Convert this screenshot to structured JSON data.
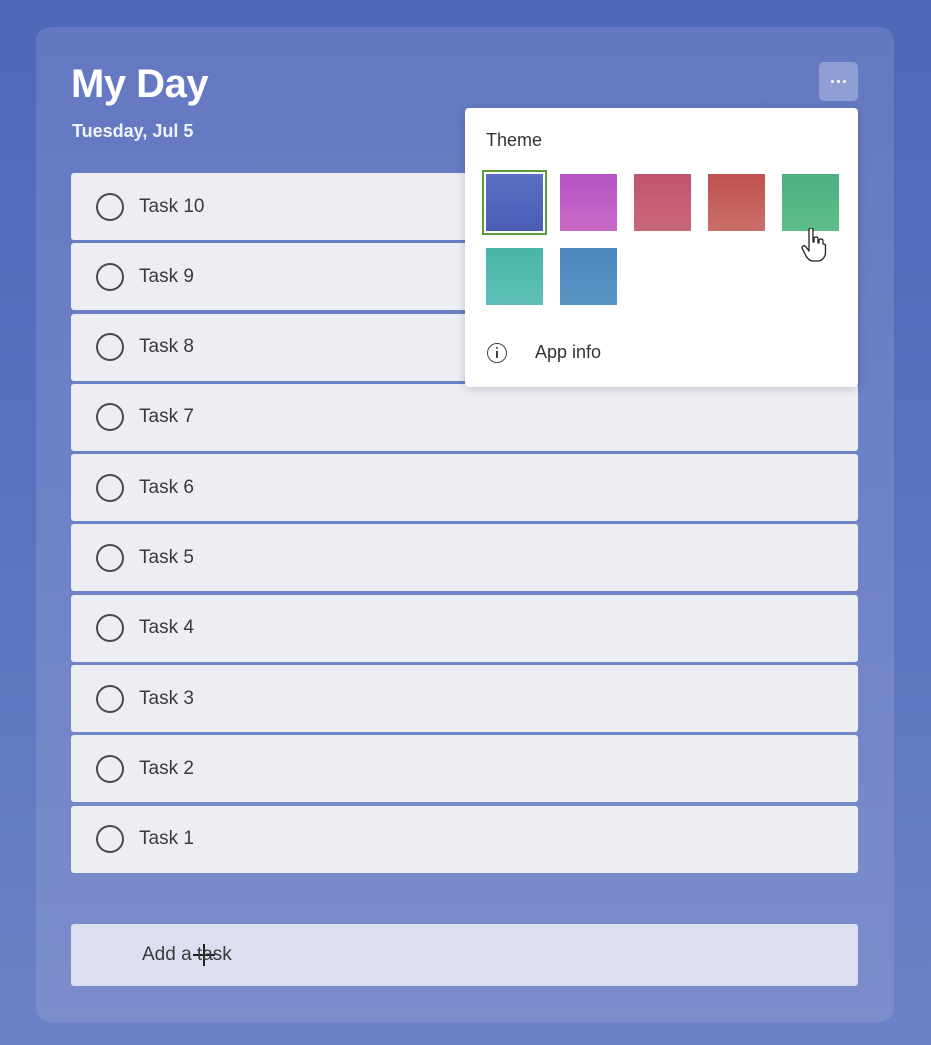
{
  "header": {
    "title": "My Day",
    "date": "Tuesday, Jul 5"
  },
  "tasks": [
    {
      "label": "Task 10"
    },
    {
      "label": "Task 9"
    },
    {
      "label": "Task 8"
    },
    {
      "label": "Task 7"
    },
    {
      "label": "Task 6"
    },
    {
      "label": "Task 5"
    },
    {
      "label": "Task 4"
    },
    {
      "label": "Task 3"
    },
    {
      "label": "Task 2"
    },
    {
      "label": "Task 1"
    }
  ],
  "add_task": {
    "label": "Add a task",
    "icon": "plus-icon"
  },
  "more_button": {
    "icon": "more-horizontal-icon"
  },
  "theme_menu": {
    "heading": "Theme",
    "swatches": [
      {
        "name": "blue",
        "from": "#5a6ec3",
        "to": "#4a5db5",
        "selected": true
      },
      {
        "name": "purple",
        "from": "#b554c4",
        "to": "#c96ac6",
        "selected": false
      },
      {
        "name": "rose",
        "from": "#bf5370",
        "to": "#c9687a",
        "selected": false
      },
      {
        "name": "red",
        "from": "#c0504d",
        "to": "#c9706b",
        "selected": false
      },
      {
        "name": "green",
        "from": "#4cb07f",
        "to": "#5fbd8a",
        "selected": false
      },
      {
        "name": "teal",
        "from": "#4ab5a9",
        "to": "#5fc0ba",
        "selected": false
      },
      {
        "name": "steel-blue",
        "from": "#4a86bb",
        "to": "#5a95c4",
        "selected": false
      }
    ],
    "app_info_label": "App info",
    "app_info_icon": "info-icon"
  },
  "colors": {
    "background": "#5066b8",
    "panel": "#6b7fc6",
    "task_bg": "#eceef4",
    "selected_outline": "#5a9e3a"
  }
}
